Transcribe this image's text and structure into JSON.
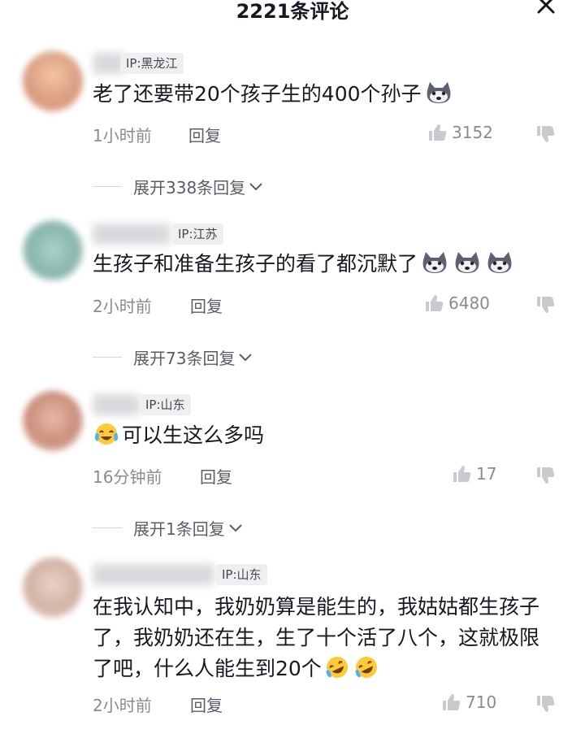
{
  "header": {
    "title": "2221条评论"
  },
  "comments": [
    {
      "ip": "IP:黑龙江",
      "text": "老了还要带20个孩子生的400个孙子",
      "time": "1小时前",
      "reply_label": "回复",
      "likes": "3152",
      "expand_label": "展开338条回复",
      "emojis": [
        "husky-emoji"
      ]
    },
    {
      "ip": "IP:江苏",
      "text": "生孩子和准备生孩子的看了都沉默了",
      "time": "2小时前",
      "reply_label": "回复",
      "likes": "6480",
      "expand_label": "展开73条回复",
      "emojis": [
        "husky-emoji",
        "husky-emoji",
        "husky-emoji"
      ]
    },
    {
      "ip": "IP:山东",
      "text": "可以生这么多吗",
      "time": "16分钟前",
      "reply_label": "回复",
      "likes": "17",
      "expand_label": "展开1条回复",
      "emojis": [
        "crying-laughing-emoji"
      ]
    },
    {
      "ip": "IP:山东",
      "text": "在我认知中，我奶奶算是能生的，我姑姑都生孩子了，我奶奶还在生，生了十个活了八个，这就极限了吧，什么人能生到20个",
      "time": "2小时前",
      "reply_label": "回复",
      "likes": "710",
      "emojis": [
        "rolling-laughing-emoji",
        "rolling-laughing-emoji"
      ]
    }
  ]
}
